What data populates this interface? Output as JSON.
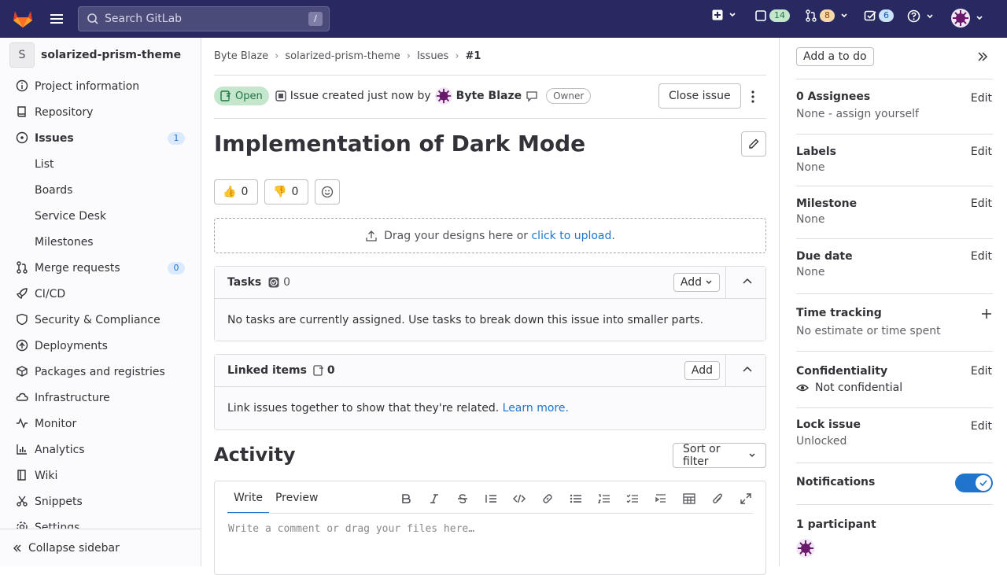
{
  "topbar": {
    "search_placeholder": "Search GitLab",
    "search_shortcut": "/",
    "issues_count": "14",
    "merge_requests_count": "8",
    "todos_count": "6"
  },
  "sidebar": {
    "project_initial": "S",
    "project_name": "solarized-prism-theme",
    "items": [
      {
        "label": "Project information",
        "icon": "info-icon"
      },
      {
        "label": "Repository",
        "icon": "repository-icon"
      },
      {
        "label": "Issues",
        "icon": "issues-icon",
        "count": "1"
      },
      {
        "label": "List",
        "icon": ""
      },
      {
        "label": "Boards",
        "icon": ""
      },
      {
        "label": "Service Desk",
        "icon": ""
      },
      {
        "label": "Milestones",
        "icon": ""
      },
      {
        "label": "Merge requests",
        "icon": "merge-request-icon",
        "count": "0"
      },
      {
        "label": "CI/CD",
        "icon": "rocket-icon"
      },
      {
        "label": "Security & Compliance",
        "icon": "shield-icon"
      },
      {
        "label": "Deployments",
        "icon": "deployments-icon"
      },
      {
        "label": "Packages and registries",
        "icon": "package-icon"
      },
      {
        "label": "Infrastructure",
        "icon": "cloud-icon"
      },
      {
        "label": "Monitor",
        "icon": "monitor-icon"
      },
      {
        "label": "Analytics",
        "icon": "chart-icon"
      },
      {
        "label": "Wiki",
        "icon": "book-icon"
      },
      {
        "label": "Snippets",
        "icon": "snippet-icon"
      },
      {
        "label": "Settings",
        "icon": "settings-icon"
      }
    ],
    "collapse_label": "Collapse sidebar"
  },
  "breadcrumb": [
    "Byte Blaze",
    "solarized-prism-theme",
    "Issues",
    "#1"
  ],
  "issue": {
    "status": "Open",
    "created_text": "Issue created just now by",
    "author": "Byte Blaze",
    "role": "Owner",
    "close_label": "Close issue",
    "title": "Implementation of Dark Mode",
    "thumbs_up": "0",
    "thumbs_down": "0",
    "upload_text": "Drag your designs here or",
    "upload_link": "click to upload",
    "upload_end": "."
  },
  "tasks": {
    "title": "Tasks",
    "count": "0",
    "add_label": "Add",
    "empty": "No tasks are currently assigned. Use tasks to break down this issue into smaller parts."
  },
  "linked": {
    "title": "Linked items",
    "count": "0",
    "add_label": "Add",
    "empty": "Link issues together to show that they're related.",
    "learn_more": "Learn more."
  },
  "activity": {
    "title": "Activity",
    "sort_label": "Sort or filter",
    "tab_write": "Write",
    "tab_preview": "Preview",
    "placeholder": "Write a comment or drag your files here…"
  },
  "right": {
    "todo_label": "Add a to do",
    "assignees_title": "0 Assignees",
    "assignees_value": "None - assign yourself",
    "labels_title": "Labels",
    "labels_value": "None",
    "milestone_title": "Milestone",
    "milestone_value": "None",
    "due_title": "Due date",
    "due_value": "None",
    "time_title": "Time tracking",
    "time_value": "No estimate or time spent",
    "conf_title": "Confidentiality",
    "conf_value": "Not confidential",
    "lock_title": "Lock issue",
    "lock_value": "Unlocked",
    "notif_title": "Notifications",
    "notifications_on": true,
    "participants_title": "1 participant",
    "edit_label": "Edit"
  },
  "colors": {
    "topbar": "#292961",
    "accent": "#1f75cb",
    "status_open_bg": "#c3e6cd",
    "status_open_text": "#217645"
  }
}
